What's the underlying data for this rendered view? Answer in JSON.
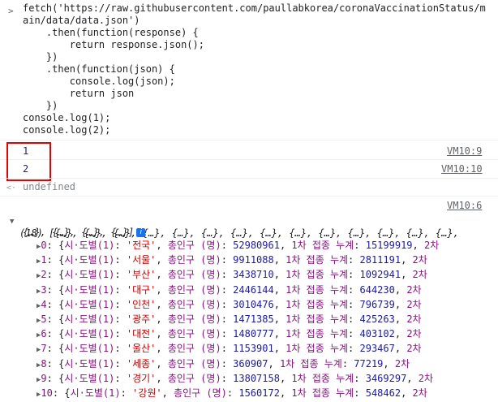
{
  "input": {
    "prompt_symbol": ">",
    "code_lines": [
      "fetch('https://raw.githubusercontent.com/paullabkorea/coronaVaccinationStatus/m",
      "ain/data/data.json')",
      "    .then(function(response) {",
      "        return response.json();",
      "    })",
      "    .then(function(json) {",
      "        console.log(json);",
      "        return json",
      "    })",
      "console.log(1);",
      "console.log(2);"
    ]
  },
  "outputs": [
    {
      "value": "1",
      "source": "VM10:9"
    },
    {
      "value": "2",
      "source": "VM10:10"
    }
  ],
  "return_value": {
    "arrow": "<·",
    "text": "undefined"
  },
  "array_log": {
    "source": "VM10:6",
    "toggle_symbol": "▼",
    "length_label": "(18)",
    "preview_line1": "[{…}, {…}, {…}, {…}, {…}, {…}, {…}, {…}, {…}, {…}, {…}, {…}, {…}, {…},",
    "preview_line2": "{…}, {…}, {…}, {…}]",
    "info_badge": "i",
    "rows": [
      {
        "index": "0",
        "region": "전국",
        "pop": "52980961",
        "first": "15199919"
      },
      {
        "index": "1",
        "region": "서울",
        "pop": "9911088",
        "first": "2811191"
      },
      {
        "index": "2",
        "region": "부산",
        "pop": "3438710",
        "first": "1092941"
      },
      {
        "index": "3",
        "region": "대구",
        "pop": "2446144",
        "first": "644230"
      },
      {
        "index": "4",
        "region": "인천",
        "pop": "3010476",
        "first": "796739"
      },
      {
        "index": "5",
        "region": "광주",
        "pop": "1471385",
        "first": "425263"
      },
      {
        "index": "6",
        "region": "대전",
        "pop": "1480777",
        "first": "403102"
      },
      {
        "index": "7",
        "region": "울산",
        "pop": "1153901",
        "first": "293467"
      },
      {
        "index": "8",
        "region": "세종",
        "pop": "360907",
        "first": "77219"
      },
      {
        "index": "9",
        "region": "경기",
        "pop": "13807158",
        "first": "3469297"
      },
      {
        "index": "10",
        "region": "강원",
        "pop": "1560172",
        "first": "548462"
      }
    ],
    "row_text": {
      "open": "{",
      "key_region": "시·도별(1)",
      "key_pop": "총인구 (명)",
      "key_first": "1차 접종 누계",
      "second_prefix": "2차"
    }
  },
  "colors": {
    "highlight_box": "#e60000",
    "string": "#c80000",
    "number": "#1a1aa6",
    "keyword": "#881280"
  }
}
